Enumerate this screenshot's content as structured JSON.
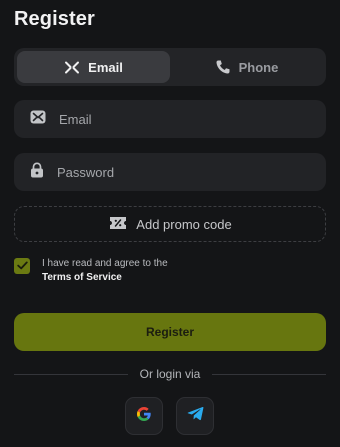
{
  "title": "Register",
  "tabs": [
    {
      "label": "Email",
      "icon": "email-icon",
      "active": true
    },
    {
      "label": "Phone",
      "icon": "phone-icon",
      "active": false
    }
  ],
  "fields": {
    "email": {
      "placeholder": "Email",
      "icon": "email-icon"
    },
    "password": {
      "placeholder": "Password",
      "icon": "lock-icon"
    }
  },
  "promo": {
    "label": "Add promo code",
    "icon": "ticket-icon"
  },
  "terms": {
    "checked": true,
    "text": "I have read and agree to the",
    "link": "Terms of Service"
  },
  "register_button": "Register",
  "divider_text": "Or login via",
  "social": [
    "google-icon",
    "telegram-icon"
  ],
  "colors": {
    "background": "#141517",
    "accent": "#67760f",
    "field": "#222326"
  }
}
